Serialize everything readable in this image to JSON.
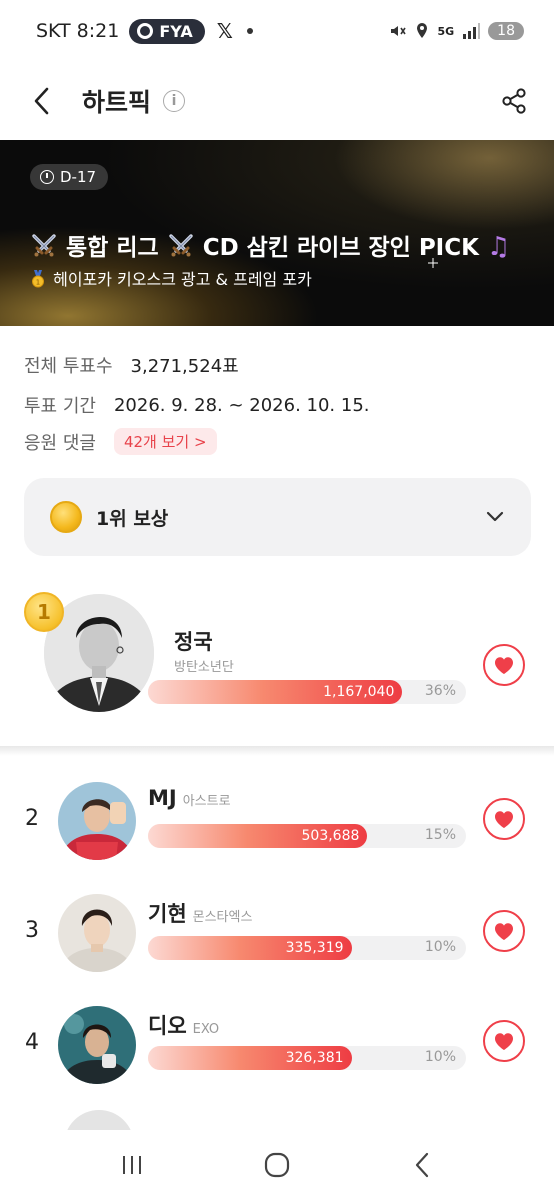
{
  "status_bar": {
    "carrier": "SKT",
    "time": "8:21",
    "pill_label": "FYA",
    "x_label": "𝕏",
    "network": "5G",
    "battery": "18"
  },
  "header": {
    "title": "하트픽",
    "info_glyph": "i"
  },
  "banner": {
    "dday": "D-17",
    "headline": "통합 리그 ⚔ CD 삼킨 라이브 장인 PICK 🎵",
    "headline_prefix": "통합 리그",
    "headline_main": "CD 삼킨 라이브 장인 PICK",
    "note_glyph": "♫",
    "sub": "헤이포카 키오스크 광고 & 프레임 포카"
  },
  "info": {
    "total_votes_label": "전체 투표수",
    "total_votes_value": "3,271,524표",
    "period_label": "투표 기간",
    "period_value": "2026. 9. 28. ~ 2026. 10. 15.",
    "comments_label": "응원 댓글",
    "comments_link": "42개 보기 >"
  },
  "reward": {
    "label": "1위 보상"
  },
  "ranking": [
    {
      "rank": "1",
      "name": "정국",
      "group": "방탄소년단",
      "votes": "1,167,040",
      "percent": "36%",
      "fill": 0.8
    },
    {
      "rank": "2",
      "name": "MJ",
      "group": "아스트로",
      "votes": "503,688",
      "percent": "15%",
      "fill": 0.69
    },
    {
      "rank": "3",
      "name": "기현",
      "group": "몬스타엑스",
      "votes": "335,319",
      "percent": "10%",
      "fill": 0.64
    },
    {
      "rank": "4",
      "name": "디오",
      "group": "EXO",
      "votes": "326,381",
      "percent": "10%",
      "fill": 0.64
    }
  ],
  "colors": {
    "accent": "#ef3f49",
    "banner_bg": "#0b0b0b",
    "reward_bg": "#f2f2f3"
  },
  "icons": {
    "back": "chevron-left-icon",
    "info": "info-icon",
    "share": "share-icon",
    "heart": "heart-icon",
    "coin": "coin-icon",
    "chevron": "chevron-down-icon"
  }
}
